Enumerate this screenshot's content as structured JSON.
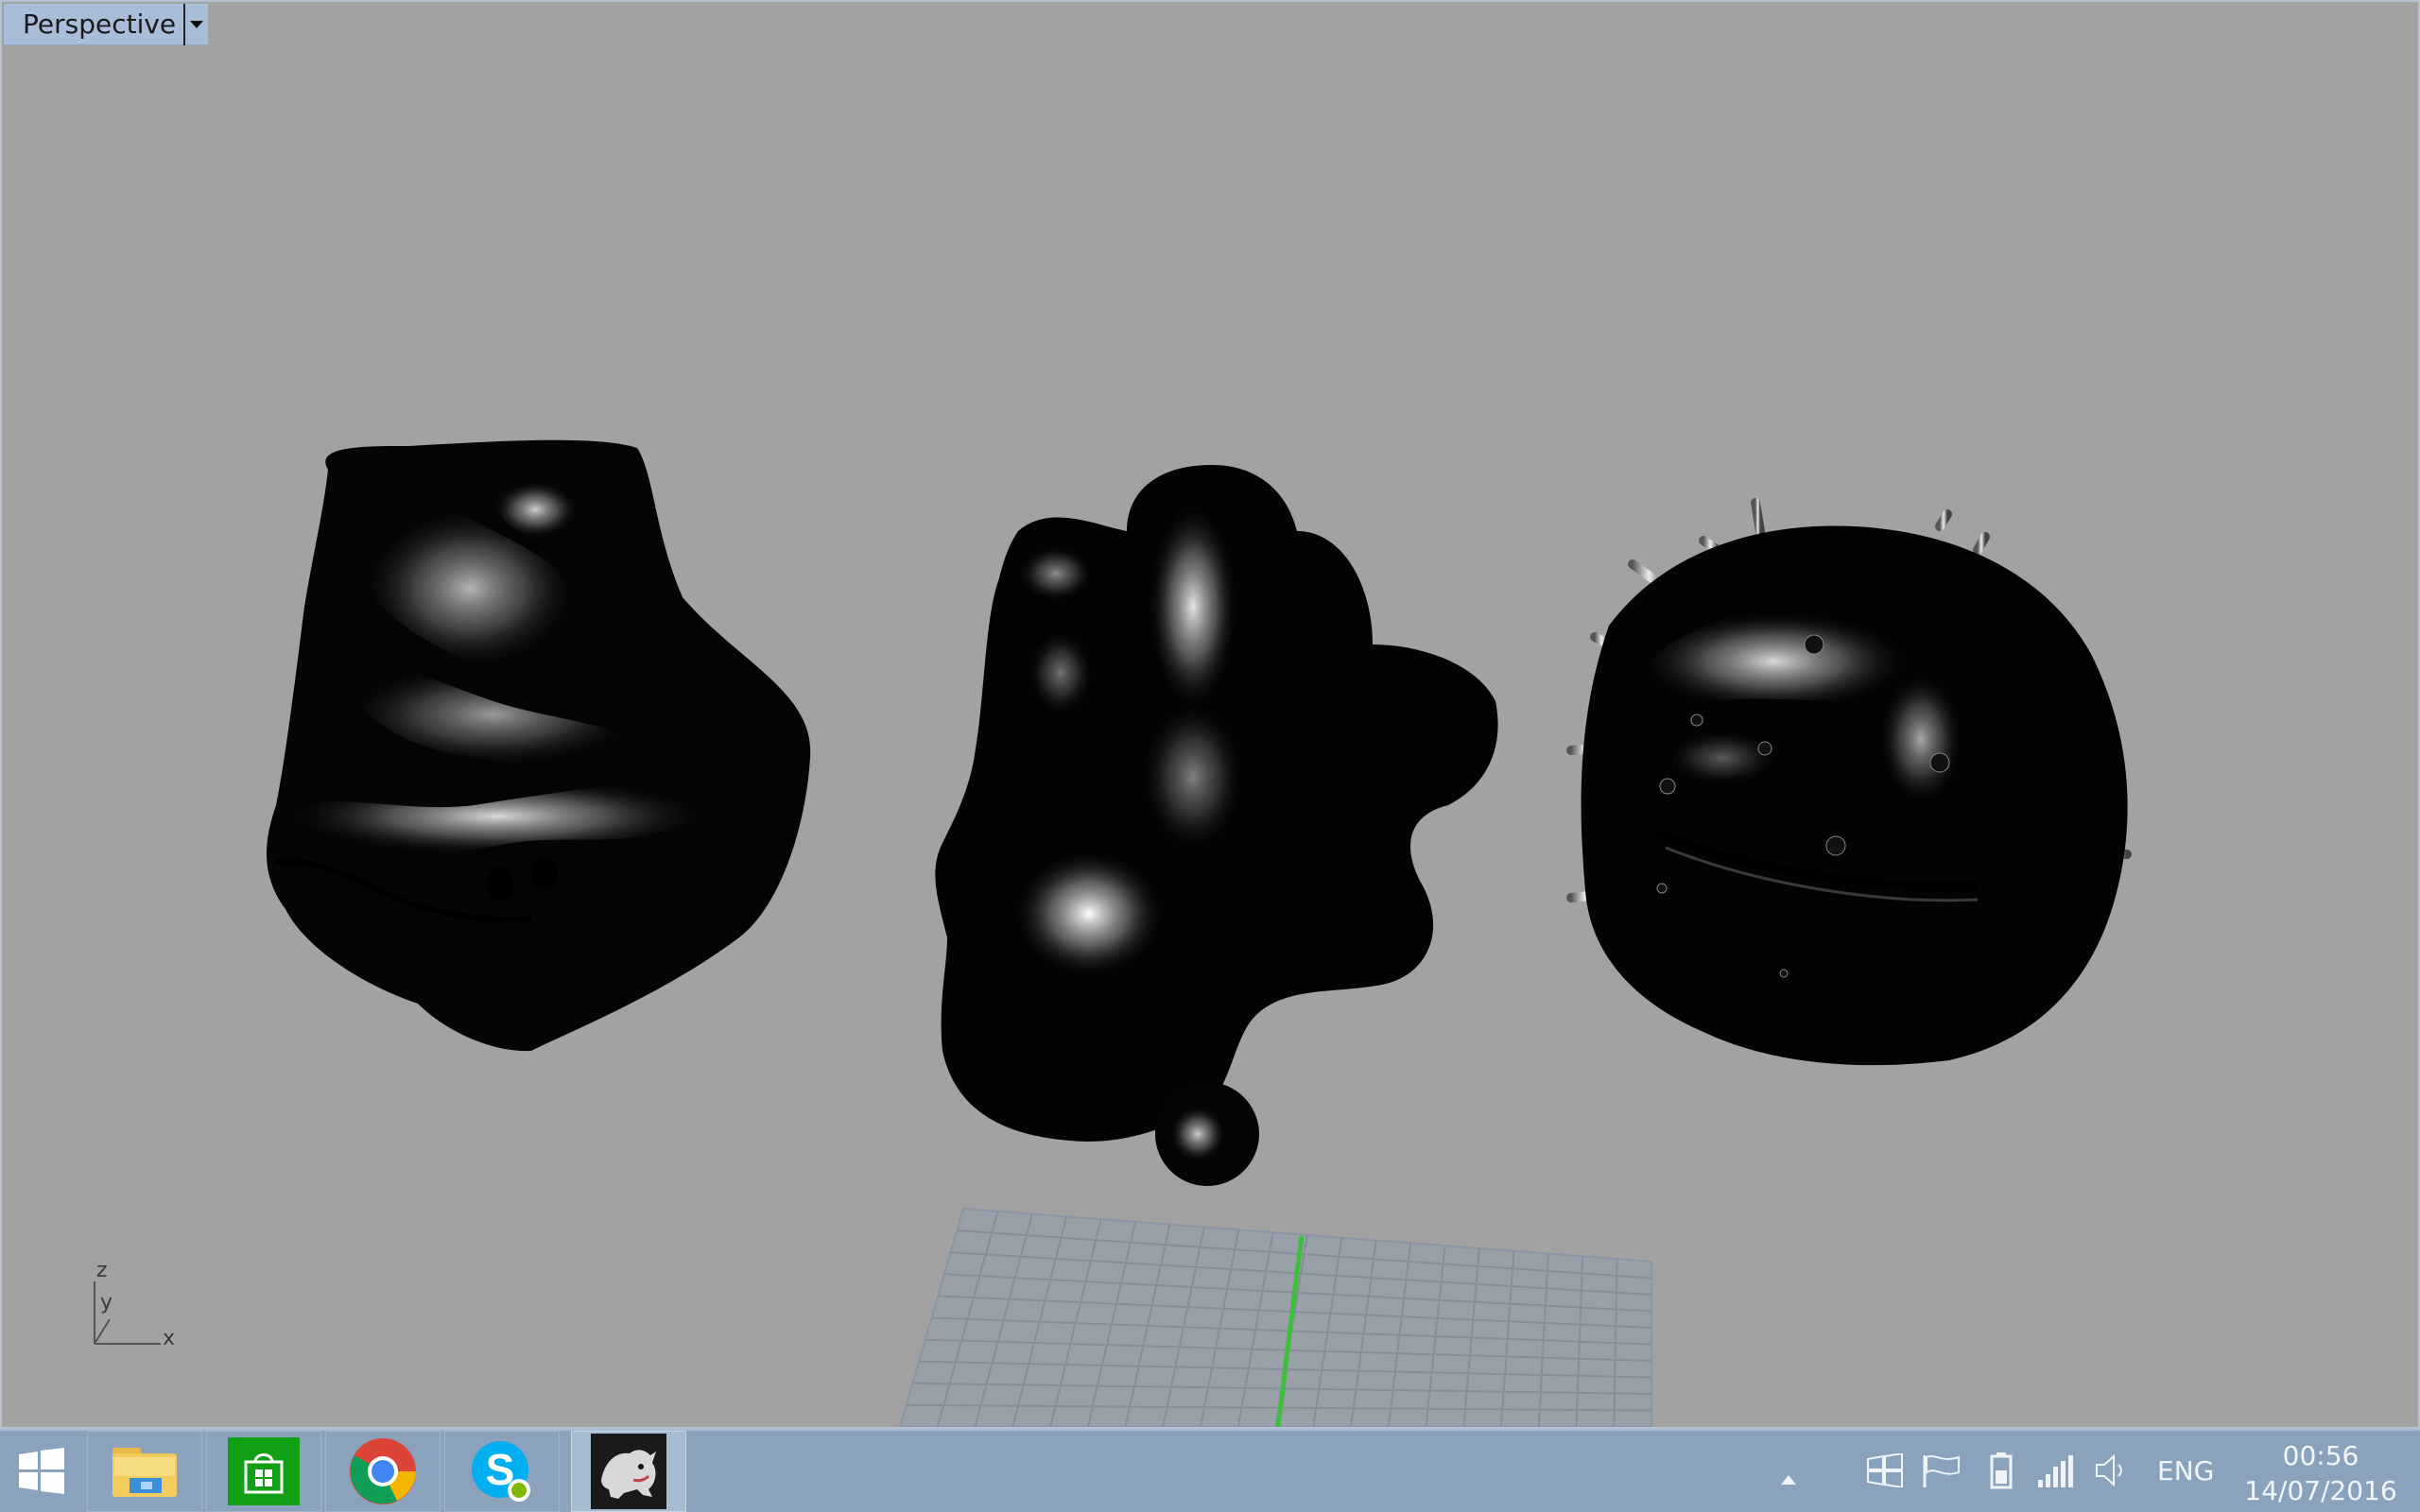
{
  "viewport": {
    "title": "Perspective",
    "background_color": "#a2a2a2"
  },
  "axis": {
    "z": "z",
    "y": "y",
    "x": "x"
  },
  "taskbar": {
    "apps": [
      {
        "name": "start-button",
        "icon": "windows-logo-icon"
      },
      {
        "name": "file-explorer",
        "icon": "folder-icon"
      },
      {
        "name": "windows-store",
        "icon": "store-bag-icon"
      },
      {
        "name": "chrome",
        "icon": "chrome-icon"
      },
      {
        "name": "skype",
        "icon": "skype-icon"
      },
      {
        "name": "rhino",
        "icon": "rhino-icon"
      }
    ],
    "tray": {
      "language": "ENG",
      "time": "00:56",
      "date": "14/07/2016"
    }
  }
}
